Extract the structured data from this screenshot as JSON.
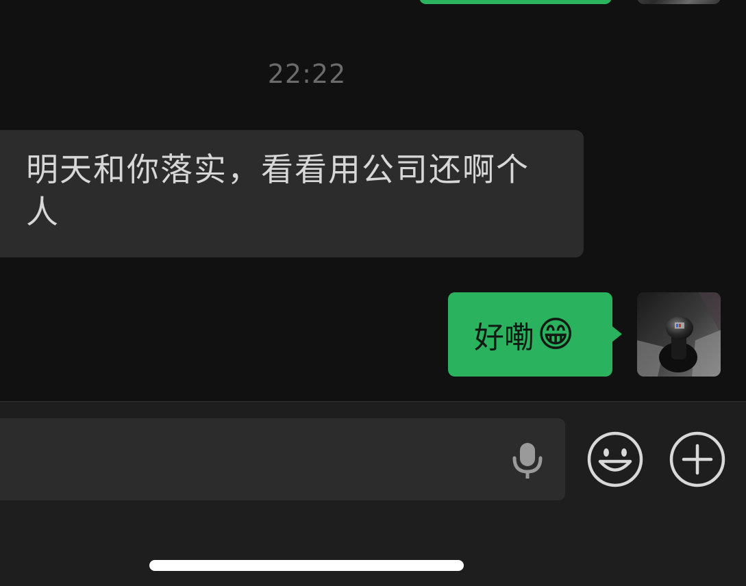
{
  "chat": {
    "timestamp": "22:22",
    "messages": [
      {
        "direction": "incoming",
        "text_line1": "明天和你落实，看看用公司还啊个",
        "text_line2": "人"
      },
      {
        "direction": "outgoing",
        "text": "好嘞",
        "emoji": "😁"
      }
    ]
  },
  "input_bar": {
    "placeholder": "",
    "icons": [
      "microphone-icon",
      "emoji-icon",
      "plus-icon"
    ]
  },
  "colors": {
    "background": "#111111",
    "incoming_bubble": "#2c2c2c",
    "outgoing_bubble": "#2ab25e",
    "timestamp": "#6b6b6b",
    "input_bar": "#1e1e1e"
  }
}
